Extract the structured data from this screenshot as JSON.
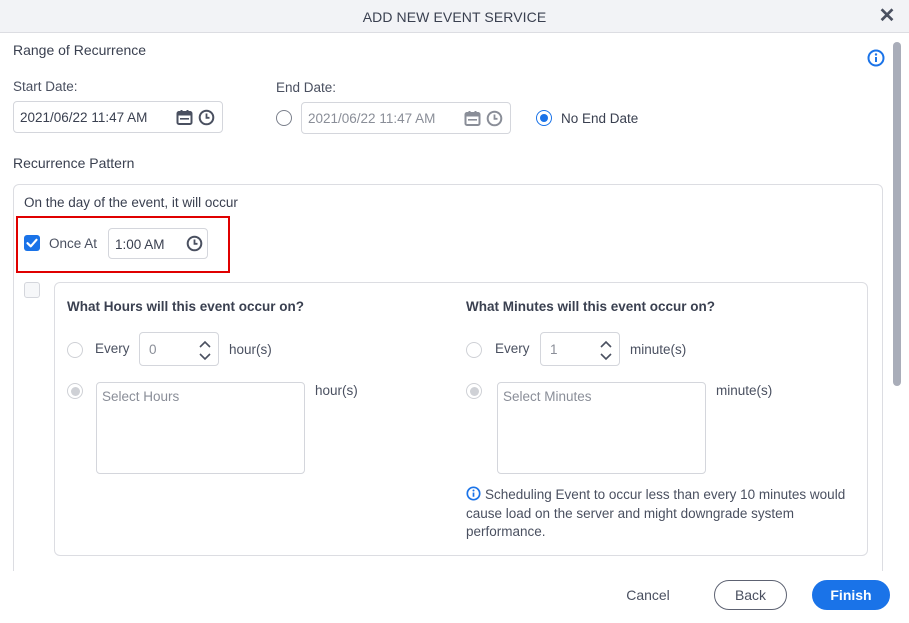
{
  "dialog": {
    "title": "ADD NEW EVENT SERVICE",
    "close_icon": "close-icon"
  },
  "range": {
    "title": "Range of Recurrence",
    "start_label": "Start Date:",
    "start_value": "2021/06/22 11:47 AM",
    "end_label": "End Date:",
    "end_value": "2021/06/22 11:47 AM",
    "end_date_selected": false,
    "no_end_label": "No End Date",
    "no_end_selected": true
  },
  "pattern": {
    "title": "Recurrence Pattern",
    "subtitle": "On the day of the event, it will occur",
    "once_at_label": "Once At",
    "once_at_checked": true,
    "once_at_value": "1:00 AM",
    "multi_checked": false,
    "hours": {
      "title": "What Hours will this event occur on?",
      "every_label": "Every",
      "every_value": "0",
      "unit": "hour(s)",
      "select_placeholder": "Select Hours",
      "select_unit": "hour(s)"
    },
    "minutes": {
      "title": "What Minutes will this event occur on?",
      "every_label": "Every",
      "every_value": "1",
      "unit": "minute(s)",
      "select_placeholder": "Select Minutes",
      "select_unit": "minute(s)",
      "note": "Scheduling Event to occur less than every 10 minutes would cause load on the server and might downgrade system performance."
    }
  },
  "footer": {
    "cancel": "Cancel",
    "back": "Back",
    "finish": "Finish"
  },
  "colors": {
    "accent": "#1a73e8",
    "highlight": "#e00000"
  }
}
